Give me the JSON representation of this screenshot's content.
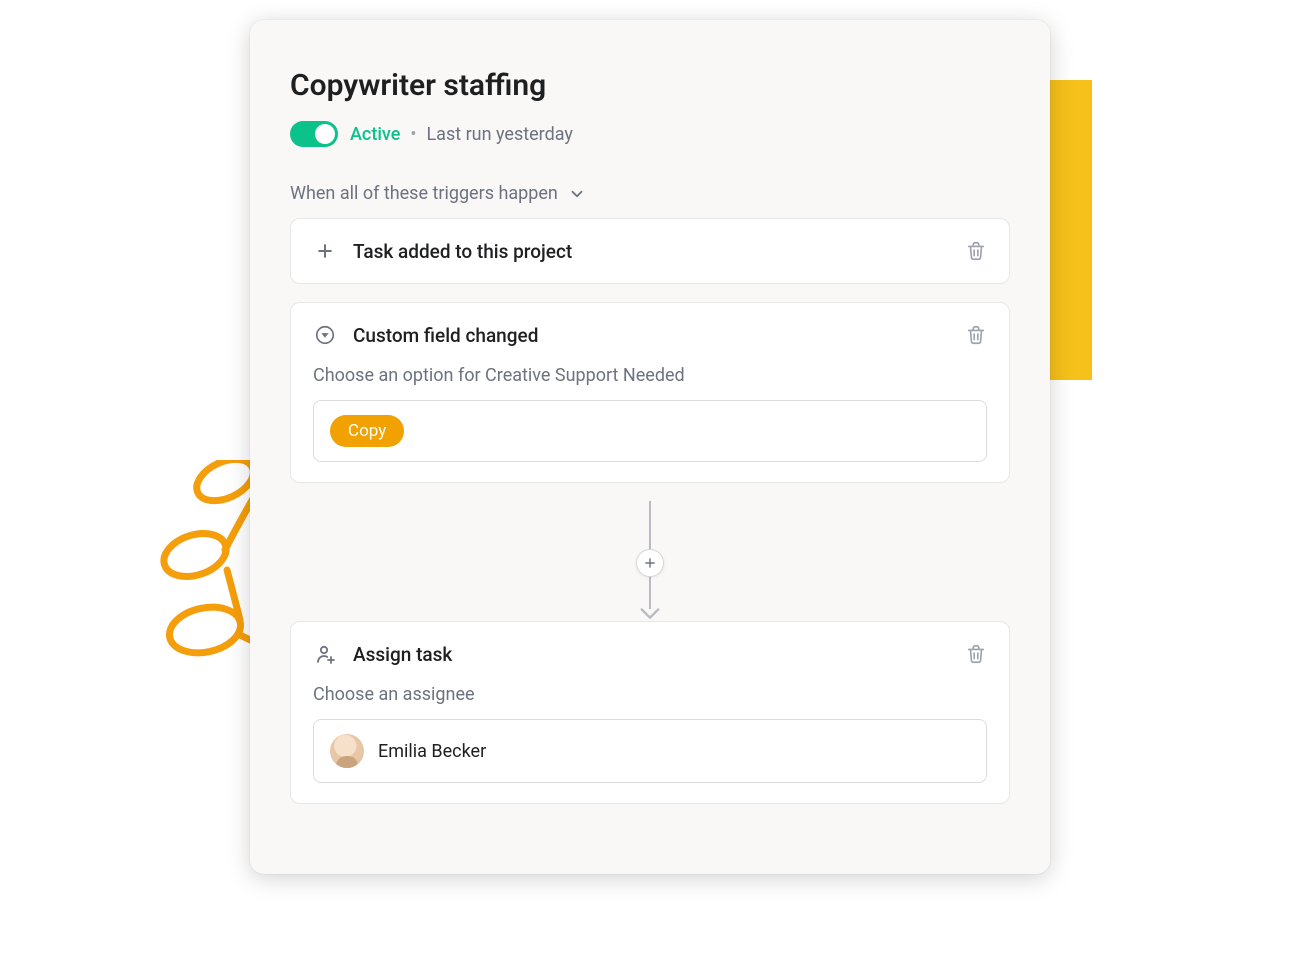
{
  "rule": {
    "title": "Copywriter staffing",
    "status_label": "Active",
    "status_separator": "•",
    "last_run": "Last run yesterday"
  },
  "triggers": {
    "section_label": "When all of these triggers happen",
    "items": [
      {
        "icon": "plus-icon",
        "title": "Task added to this project"
      },
      {
        "icon": "caret-down-circle-icon",
        "title": "Custom field changed",
        "subtitle": "Choose an option for Creative Support Needed",
        "chip": "Copy"
      }
    ]
  },
  "actions": {
    "items": [
      {
        "icon": "assign-user-icon",
        "title": "Assign task",
        "subtitle": "Choose an assignee",
        "assignee_name": "Emilia Becker"
      }
    ]
  }
}
